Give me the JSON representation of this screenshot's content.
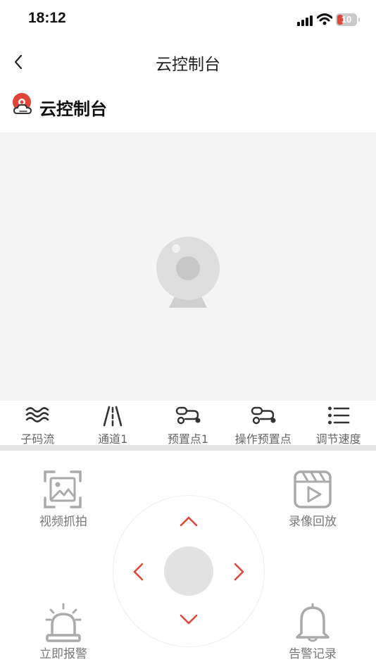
{
  "status_bar": {
    "time": "18:12",
    "battery_level": "10"
  },
  "nav": {
    "title": "云控制台"
  },
  "section": {
    "title": "云控制台"
  },
  "toolbar": [
    {
      "label": "子码流",
      "icon": "wave-icon"
    },
    {
      "label": "通道1",
      "icon": "road-icon"
    },
    {
      "label": "预置点1",
      "icon": "preset-icon"
    },
    {
      "label": "操作预置点",
      "icon": "preset-operate-icon"
    },
    {
      "label": "调节速度",
      "icon": "list-icon"
    }
  ],
  "actions": {
    "snapshot": "视频抓拍",
    "playback": "录像回放",
    "alarm": "立即报警",
    "alarm_log": "告警记录"
  },
  "colors": {
    "accent": "#e0453a",
    "icon_gray": "#aaaaaa",
    "video_bg": "#f4f4f4"
  }
}
